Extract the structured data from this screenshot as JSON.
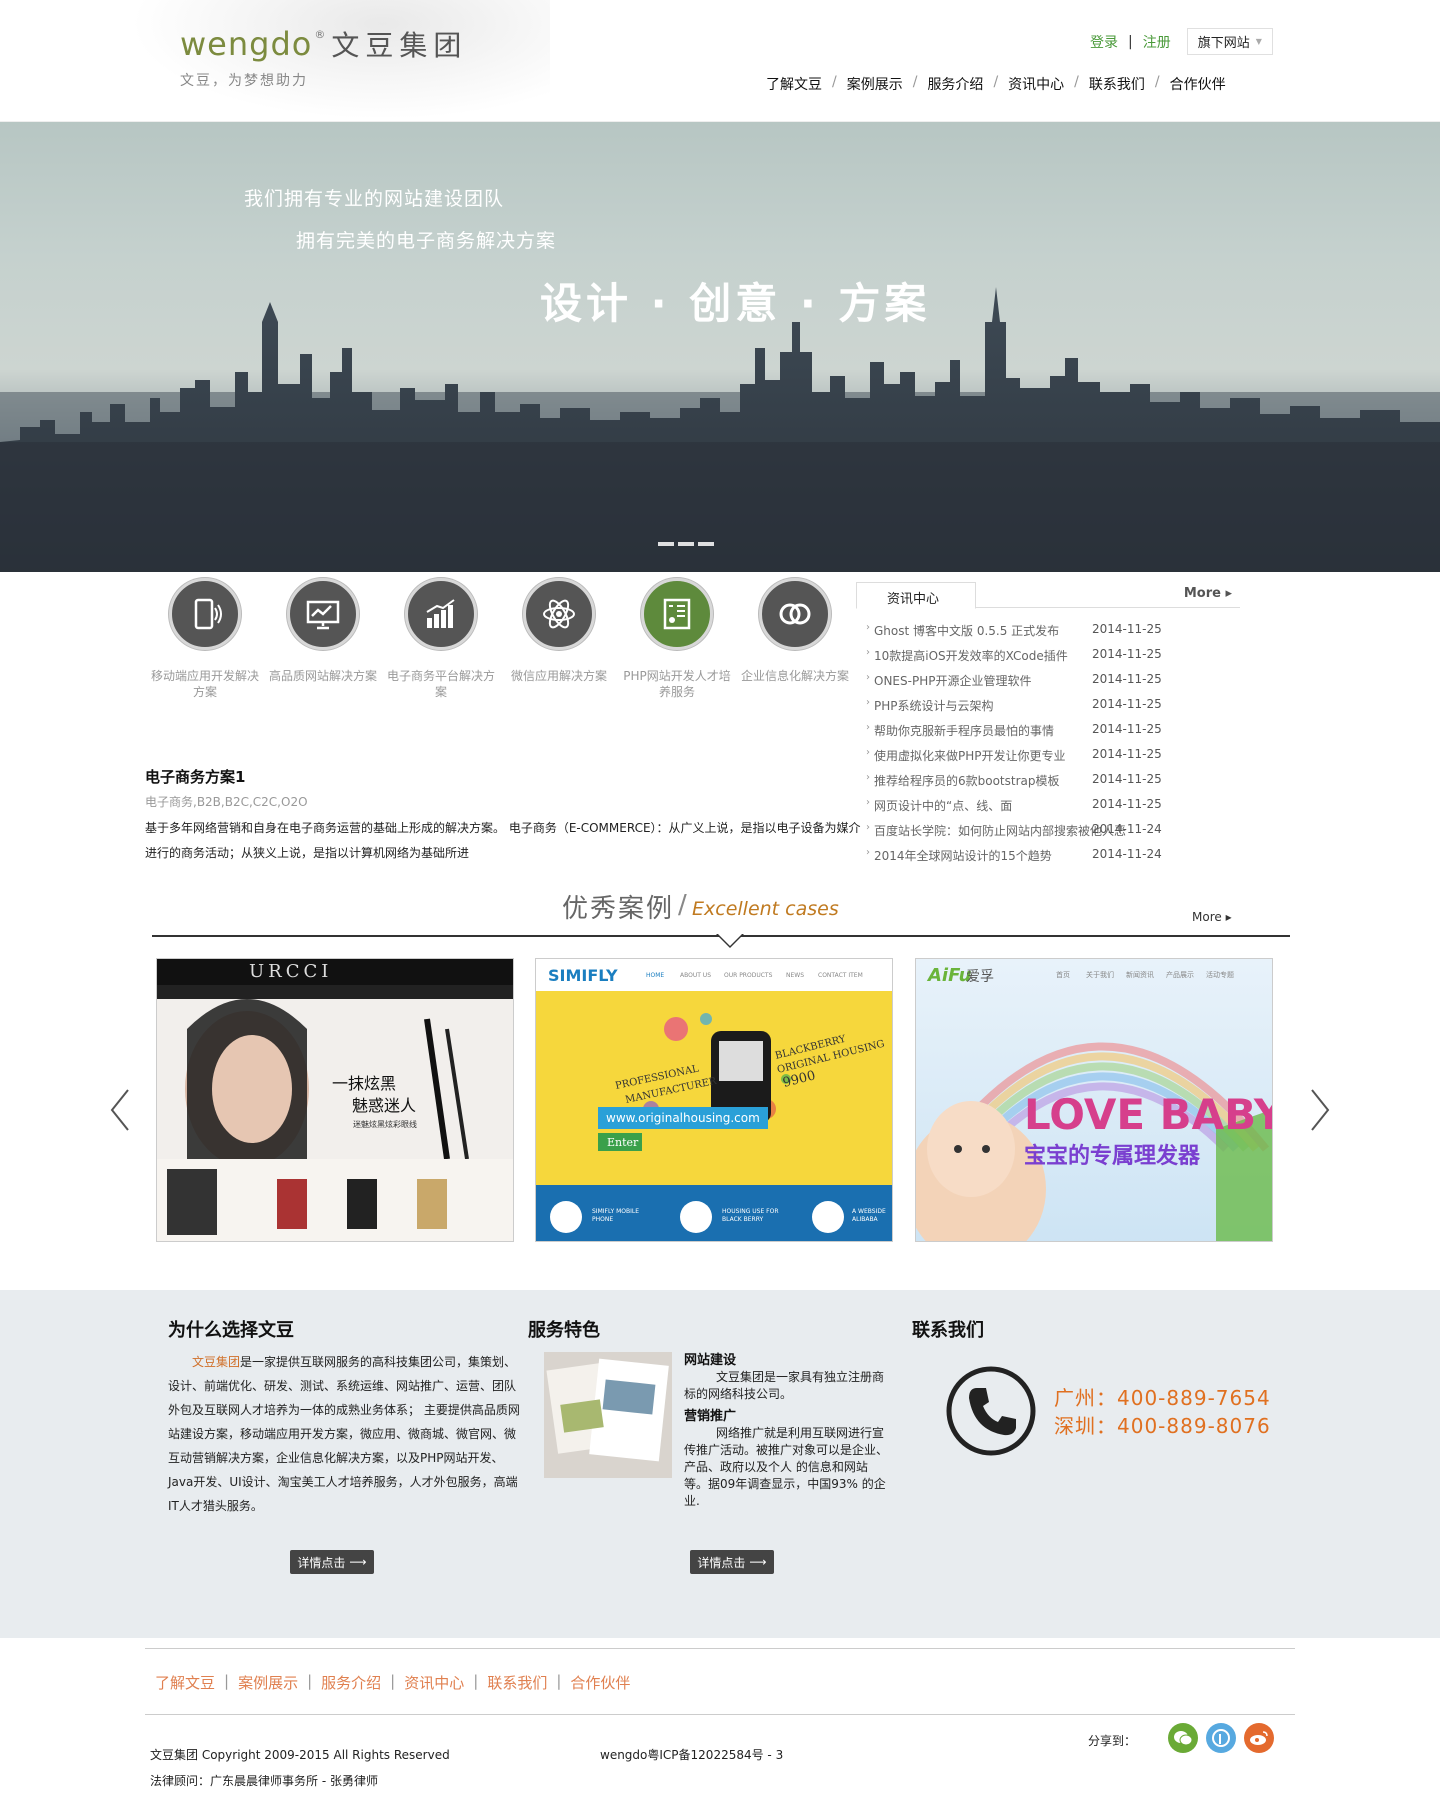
{
  "header": {
    "logo_en": "wengdo",
    "logo_reg": "®",
    "logo_cn": "文豆集团",
    "slogan": "文豆，为梦想助力",
    "login": "登录",
    "register": "注册",
    "link_sep": "|",
    "subsite_label": "旗下网站",
    "nav": [
      "了解文豆",
      "案例展示",
      "服务介绍",
      "资讯中心",
      "联系我们",
      "合作伙伴"
    ],
    "nav_sep": "/"
  },
  "banner": {
    "line1": "我们拥有专业的网站建设团队",
    "line2": "拥有完美的电子商务解决方案",
    "headline": "设计 · 创意 · 方案",
    "slide_count": 3
  },
  "services": [
    {
      "label": "移动端应用开发解决方案",
      "icon": "mobile-icon"
    },
    {
      "label": "高品质网站解决方案",
      "icon": "presentation-icon"
    },
    {
      "label": "电子商务平台解决方案",
      "icon": "bar-chart-icon"
    },
    {
      "label": "微信应用解决方案",
      "icon": "atom-icon"
    },
    {
      "label": "PHP网站开发人才培养服务",
      "icon": "document-user-icon"
    },
    {
      "label": "企业信息化解决方案",
      "icon": "rings-icon"
    }
  ],
  "solution": {
    "title": "电子商务方案1",
    "tags": "电子商务,B2B,B2C,C2C,O2O",
    "desc": "基于多年网络营销和自身在电子商务运营的基础上形成的解决方案。 电子商务（E-COMMERCE）：从广义上说，是指以电子设备为媒介进行的商务活动；从狭义上说，是指以计算机网络为基础所进"
  },
  "news": {
    "tab": "资讯中心",
    "more": "More ▸",
    "items": [
      {
        "title": "Ghost 博客中文版 0.5.5 正式发布",
        "date": "2014-11-25"
      },
      {
        "title": "10款提高iOS开发效率的XCode插件",
        "date": "2014-11-25"
      },
      {
        "title": "ONES-PHP开源企业管理软件",
        "date": "2014-11-25"
      },
      {
        "title": "PHP系统设计与云架构",
        "date": "2014-11-25"
      },
      {
        "title": "帮助你克服新手程序员最怕的事情",
        "date": "2014-11-25"
      },
      {
        "title": "使用虚拟化来做PHP开发让你更专业",
        "date": "2014-11-25"
      },
      {
        "title": "推荐给程序员的6款bootstrap模板",
        "date": "2014-11-25"
      },
      {
        "title": "网页设计中的“点、线、面",
        "date": "2014-11-25"
      },
      {
        "title": "百度站长学院：如何防止网站内部搜索被他人恶",
        "date": "2014-11-24"
      },
      {
        "title": "2014年全球网站设计的15个趋势",
        "date": "2014-11-24"
      }
    ]
  },
  "cases": {
    "title_cn": "优秀案例",
    "slash": "/",
    "title_en": "Excellent cases",
    "more": "More ▸",
    "items": [
      {
        "name": "URCCI",
        "tagline1": "一抹炫黑",
        "tagline2": "魅惑迷人",
        "tagline3": "迷魅炫黑炫彩眼线"
      },
      {
        "name": "SIMIFLY",
        "nav": [
          "HOME",
          "ABOUT US",
          "OUR PRODUCTS",
          "NEWS",
          "CONTACT ITEM"
        ],
        "promo1": "PROFESSIONAL",
        "promo2": "MANUFACTURER",
        "promo3": "BLACKBERRY",
        "promo4": "ORIGINAL HOUSING",
        "promo5": "9900",
        "url": "www.originalhousing.com",
        "enter": "Enter",
        "footer1": "SIMIFLY MOBILE",
        "footer2": "PHONE",
        "footer3": "HOUSING USE FOR",
        "footer4": "BLACK BERRY",
        "footer5": "A WEBSIDE",
        "footer6": "ALIBABA"
      },
      {
        "name": "AiFu",
        "name_cn": "爱孚",
        "nav": [
          "首页",
          "关于我们",
          "新闻资讯",
          "产品展示",
          "活动专题"
        ],
        "headline": "LOVE BABY",
        "sub": "宝宝的专属理发器"
      }
    ]
  },
  "info": {
    "why_title": "为什么选择文豆",
    "why_highlight": "文豆集团",
    "why_text": "是一家提供互联网服务的高科技集团公司，集策划、设计、前端优化、研发、测试、系统运维、网站推广、运营、团队外包及互联网人才培养为一体的成熟业务体系； 主要提供高品质网站建设方案，移动端应用开发方案，微应用、微商城、微官网、微互动营销解决方案，企业信息化解决方案，以及PHP网站开发、Java开发、UI设计、淘宝美工人才培养服务，人才外包服务，高端IT人才猎头服务。",
    "feature_title": "服务特色",
    "feature1_title": "网站建设",
    "feature1_text": "文豆集团是一家具有独立注册商标的网络科技公司。",
    "feature2_title": "营销推广",
    "feature2_text": "网络推广就是利用互联网进行宣传推广活动。被推广对象可以是企业、产品、政府以及个人 的信息和网站等。据09年调查显示，中国93% 的企业.",
    "detail_btn": "详情点击",
    "contact_title": "联系我们",
    "phone_gz": "广州：400-889-7654",
    "phone_sz": "深圳：400-889-8076"
  },
  "footer": {
    "nav": [
      "了解文豆",
      "案例展示",
      "服务介绍",
      "资讯中心",
      "联系我们",
      "合作伙伴"
    ],
    "nav_sep": "|",
    "copyright": "文豆集团 Copyright 2009-2015 All Rights Reserved",
    "icp": "wengdo粤ICP备12022584号 - 3",
    "legal": "法律顾问：广东晨晨律师事务所 - 张勇律师",
    "share_label": "分享到：",
    "share_icons": [
      {
        "name": "wechat-icon",
        "color": "#6aaa36"
      },
      {
        "name": "tencent-weibo-icon",
        "color": "#57a9e0"
      },
      {
        "name": "sina-weibo-icon",
        "color": "#e46a2e"
      }
    ]
  },
  "colors": {
    "brand_green": "#7c8b3f",
    "link_green": "#4a9a3a",
    "accent_orange": "#e07020",
    "dark_icon": "#555555",
    "active_icon": "#5e8a3c"
  }
}
